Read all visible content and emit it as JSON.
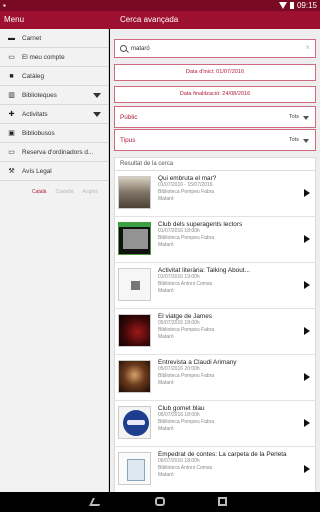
{
  "status_bar": {
    "time": "09:15"
  },
  "actionbar": {
    "menu_title": "Menu",
    "screen_title": "Cerca avançada"
  },
  "sidebar": {
    "items": [
      {
        "label": "Carnet",
        "icon": "id-card-icon"
      },
      {
        "label": "El meu compte",
        "icon": "user-icon"
      },
      {
        "label": "Catàleg",
        "icon": "folder-icon"
      },
      {
        "label": "Biblioteques",
        "icon": "books-icon",
        "expandable": true
      },
      {
        "label": "Activitats",
        "icon": "pin-icon",
        "expandable": true
      },
      {
        "label": "Bibliobusos",
        "icon": "bus-icon"
      },
      {
        "label": "Reserva d'ordinadors d...",
        "icon": "monitor-icon"
      },
      {
        "label": "Avís Legal",
        "icon": "gavel-icon"
      }
    ],
    "languages": [
      {
        "label": "Català",
        "active": true
      },
      {
        "label": "Castellà",
        "active": false
      },
      {
        "label": "Anglès",
        "active": false
      }
    ]
  },
  "search": {
    "query": "mataró",
    "date_start": "Data d'inici: 01/07/2016",
    "date_end": "Data finalització: 24/08/2016",
    "public": {
      "label": "Públic",
      "value": "Tots"
    },
    "tipus": {
      "label": "Tipus",
      "value": "Tots"
    }
  },
  "results": {
    "header": "Resultat de la cerca",
    "items": [
      {
        "title": "Qui embruta el mar?",
        "date": "01/07/2016 - 15/07/2016",
        "library": "Biblioteca Pompeu Fabra",
        "city": "Mataró"
      },
      {
        "title": "Club dels superagents lectors",
        "date": "01/07/2016 18:00h",
        "library": "Biblioteca Pompeu Fabra",
        "city": "Mataró"
      },
      {
        "title": "Activitat literària: Talking About...",
        "date": "01/07/2016 19:00h",
        "library": "Biblioteca Antoni Comas",
        "city": "Mataró"
      },
      {
        "title": "El viatge de James",
        "date": "05/07/2016 18:00h",
        "library": "Biblioteca Pompeu Fabra",
        "city": "Mataró"
      },
      {
        "title": "Entrevista a Claudi Arimany",
        "date": "05/07/2016 20:00h",
        "library": "Biblioteca Pompeu Fabra",
        "city": "Mataró"
      },
      {
        "title": "Club gomet blau",
        "date": "06/07/2016 18:00h",
        "library": "Biblioteca Pompeu Fabra",
        "city": "Mataró"
      },
      {
        "title": "Empedrat de contes: La carpeta de la Perleta",
        "date": "06/07/2016 18:00h",
        "library": "Biblioteca Antoni Comas",
        "city": "Mataró"
      }
    ]
  }
}
